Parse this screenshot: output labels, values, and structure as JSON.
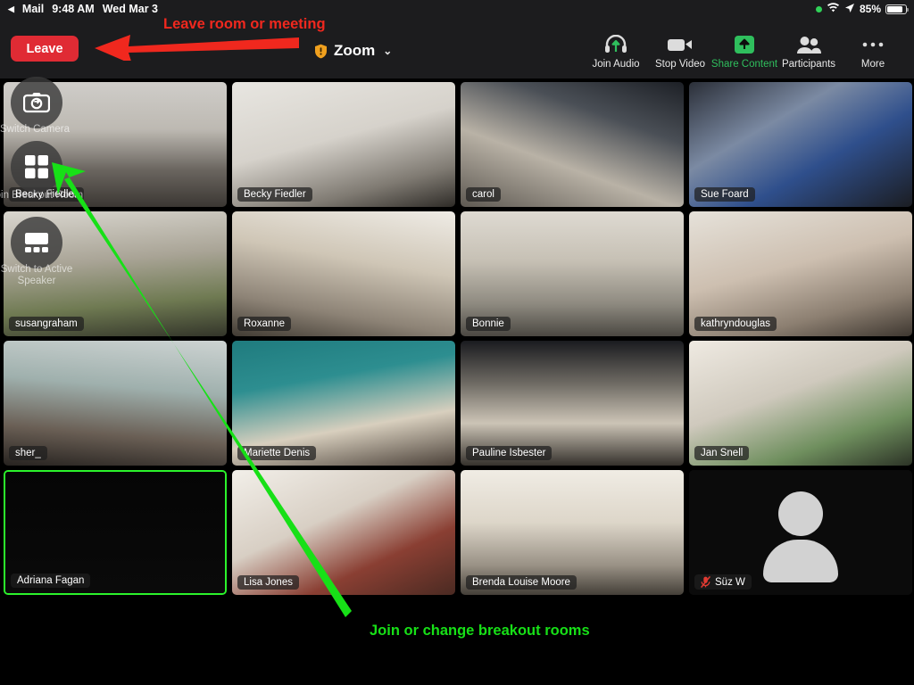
{
  "status_bar": {
    "back_app": "Mail",
    "back_icon": "back-triangle-icon",
    "time": "9:48 AM",
    "date": "Wed Mar 3",
    "recording_dot": "green-dot-icon",
    "wifi_icon": "wifi-icon",
    "location_icon": "location-arrow-icon",
    "battery_percent": "85%",
    "battery_icon": "battery-icon"
  },
  "topbar": {
    "leave_label": "Leave",
    "meeting_title": "Zoom",
    "shield_icon": "shield-warning-icon",
    "chevron_icon": "chevron-down-icon",
    "items": [
      {
        "label": "Join Audio",
        "icon": "headset-join-audio-icon",
        "active": false
      },
      {
        "label": "Stop Video",
        "icon": "video-camera-icon",
        "active": false
      },
      {
        "label": "Share Content",
        "icon": "share-up-arrow-icon",
        "active": true
      },
      {
        "label": "Participants",
        "icon": "participants-icon",
        "active": false
      },
      {
        "label": "More",
        "icon": "more-ellipsis-icon",
        "active": false
      }
    ]
  },
  "floating_controls": [
    {
      "label": "Switch Camera",
      "icon": "switch-camera-icon"
    },
    {
      "label": "Join Breakout Room",
      "icon": "breakout-rooms-grid-icon"
    },
    {
      "label": "Switch to Active Speaker",
      "icon": "active-speaker-layout-icon"
    }
  ],
  "gallery": {
    "rows": 4,
    "cols": 4,
    "participants": [
      {
        "name": "Becky Fiedler",
        "muted": false,
        "speaking": false,
        "video": true
      },
      {
        "name": "Becky Fiedler",
        "muted": false,
        "speaking": false,
        "video": true
      },
      {
        "name": "carol",
        "muted": false,
        "speaking": false,
        "video": true
      },
      {
        "name": "Sue Foard",
        "muted": false,
        "speaking": false,
        "video": true
      },
      {
        "name": "susangraham",
        "muted": false,
        "speaking": false,
        "video": true
      },
      {
        "name": "Roxanne",
        "muted": false,
        "speaking": false,
        "video": true
      },
      {
        "name": "Bonnie",
        "muted": false,
        "speaking": false,
        "video": true
      },
      {
        "name": "kathryndouglas",
        "muted": false,
        "speaking": false,
        "video": true
      },
      {
        "name": "sher_",
        "muted": false,
        "speaking": false,
        "video": true
      },
      {
        "name": "Mariette Denis",
        "muted": false,
        "speaking": false,
        "video": true
      },
      {
        "name": "Pauline Isbester",
        "muted": false,
        "speaking": false,
        "video": true
      },
      {
        "name": "Jan Snell",
        "muted": false,
        "speaking": false,
        "video": true
      },
      {
        "name": "Adriana Fagan",
        "muted": false,
        "speaking": true,
        "video": true
      },
      {
        "name": "Lisa Jones",
        "muted": false,
        "speaking": false,
        "video": true
      },
      {
        "name": "Brenda Louise Moore",
        "muted": false,
        "speaking": false,
        "video": true
      },
      {
        "name": "Süz W",
        "muted": true,
        "speaking": false,
        "video": false
      }
    ]
  },
  "annotations": [
    {
      "text": "Leave room or meeting",
      "color": "#f0281e",
      "arrow": "red-arrow-left"
    },
    {
      "text": "Join or change breakout rooms",
      "color": "#17e017",
      "arrow": "green-arrow-up-left"
    }
  ],
  "colors": {
    "leave_red": "#e02b34",
    "share_green": "#2fbf5d",
    "speaking_green": "#2bf32b",
    "annotation_red": "#f0281e",
    "annotation_green": "#17e017",
    "chrome_bg": "#1c1c1e"
  }
}
